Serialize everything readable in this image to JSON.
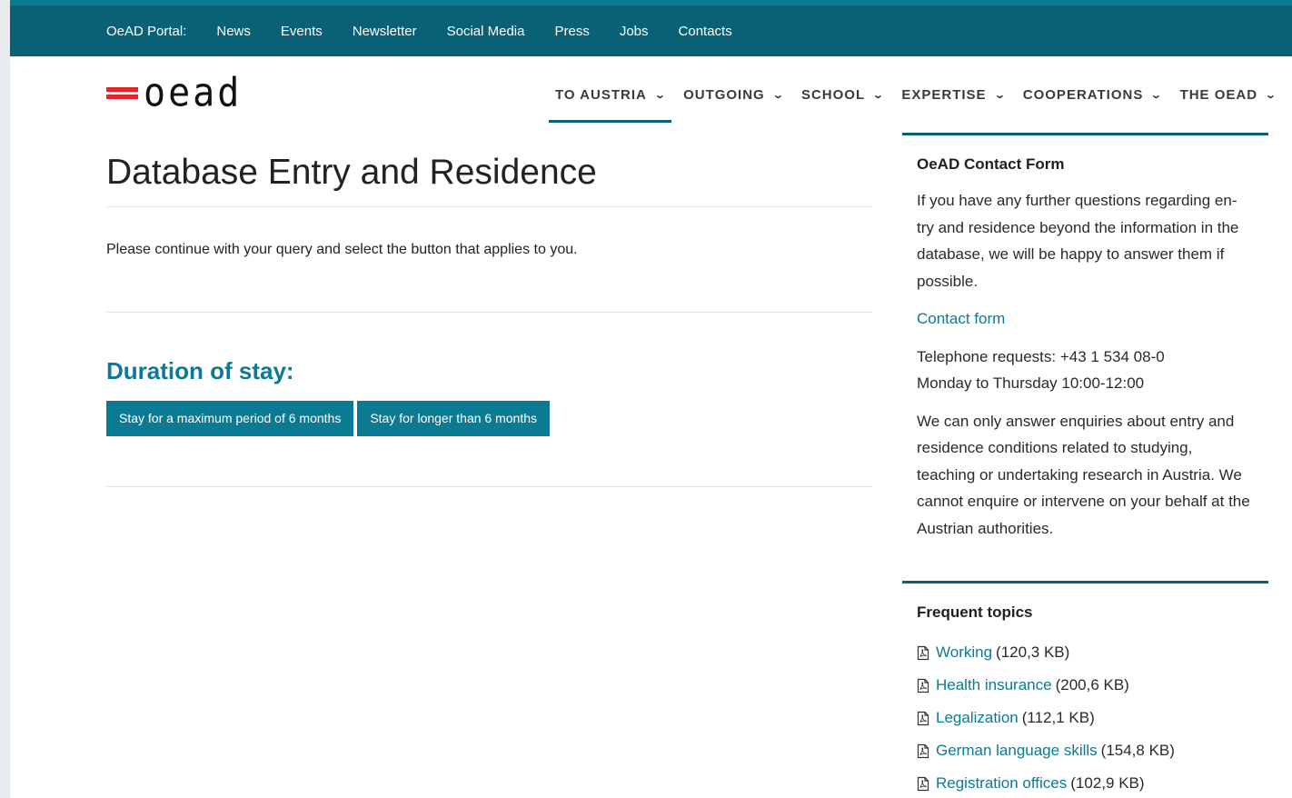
{
  "topbar": {
    "portal_label": "OeAD Portal:",
    "links": [
      "News",
      "Events",
      "Newsletter",
      "Social Media",
      "Press",
      "Jobs",
      "Contacts"
    ]
  },
  "logo": {
    "text": "oead"
  },
  "main_nav": [
    {
      "label": "TO AUSTRIA",
      "active": true
    },
    {
      "label": "OUTGOING",
      "active": false
    },
    {
      "label": "SCHOOL",
      "active": false
    },
    {
      "label": "EXPERTISE",
      "active": false
    },
    {
      "label": "COOPERATIONS",
      "active": false
    },
    {
      "label": "THE OEAD",
      "active": false
    }
  ],
  "main": {
    "title": "Database Entry and Residence",
    "intro": "Please continue with your query and select the button that applies to you.",
    "section_heading": "Duration of stay:",
    "buttons": [
      "Stay for a maximum period of 6 months",
      "Stay for longer than 6 months"
    ]
  },
  "contact_box": {
    "heading": "OeAD Contact Form",
    "text1": "If you have any further questions regarding en-try and residence beyond the information in the database, we will be happy to answer them if possible.",
    "link": "Contact form",
    "phone": "Telephone requests: +43 1 534 08-0",
    "hours": "Monday to Thursday 10:00-12:00",
    "text2": "We can only answer enquiries about entry and residence conditions related to studying, teaching or undertaking research in Austria. We cannot enquire or intervene on your behalf at the Austrian authorities."
  },
  "topics_box": {
    "heading": "Frequent topics",
    "items": [
      {
        "label": "Working",
        "size": "(120,3 KB)"
      },
      {
        "label": "Health insurance",
        "size": "(200,6 KB)"
      },
      {
        "label": "Legalization",
        "size": "(112,1 KB)"
      },
      {
        "label": "German language skills",
        "size": "(154,8 KB)"
      },
      {
        "label": "Registration offices",
        "size": "(102,9 KB)"
      }
    ]
  },
  "colors": {
    "topbar": "#0a6074",
    "accent": "#0b7a93",
    "flag_red": "#e3262b"
  }
}
